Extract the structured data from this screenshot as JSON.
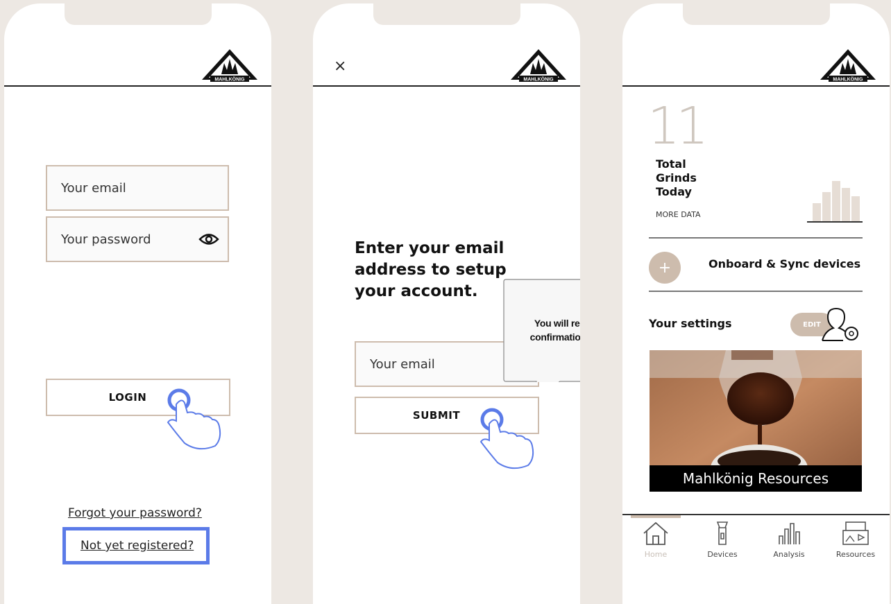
{
  "brand": {
    "logo_text": "MAHLKÖNIG"
  },
  "login_screen": {
    "email_placeholder": "Your email",
    "password_placeholder": "Your password",
    "login_label": "LOGIN",
    "forgot_password": "Forgot your password?",
    "not_registered": "Not yet registered?"
  },
  "register_screen": {
    "close_icon": "×",
    "heading": "Enter your email address to setup your account.",
    "email_placeholder": "Your email",
    "submit_label": "SUBMIT",
    "tooltip": "You will receive a confirmation email."
  },
  "dashboard_screen": {
    "total_grinds_value": "11",
    "total_grinds_label": "Total Grinds Today",
    "more_data": "MORE DATA",
    "onboard_label": "Onboard & Sync devices",
    "settings_label": "Your settings",
    "edit_label": "EDIT",
    "resource_caption": "Mahlkönig Resources",
    "nav": [
      {
        "label": "Home",
        "icon": "home-icon"
      },
      {
        "label": "Devices",
        "icon": "grinder-icon"
      },
      {
        "label": "Analysis",
        "icon": "bar-chart-icon"
      },
      {
        "label": "Resources",
        "icon": "media-icon"
      }
    ]
  },
  "colors": {
    "accent": "#cdbcad",
    "highlight": "#5b7be8",
    "background": "#ede8e3"
  }
}
